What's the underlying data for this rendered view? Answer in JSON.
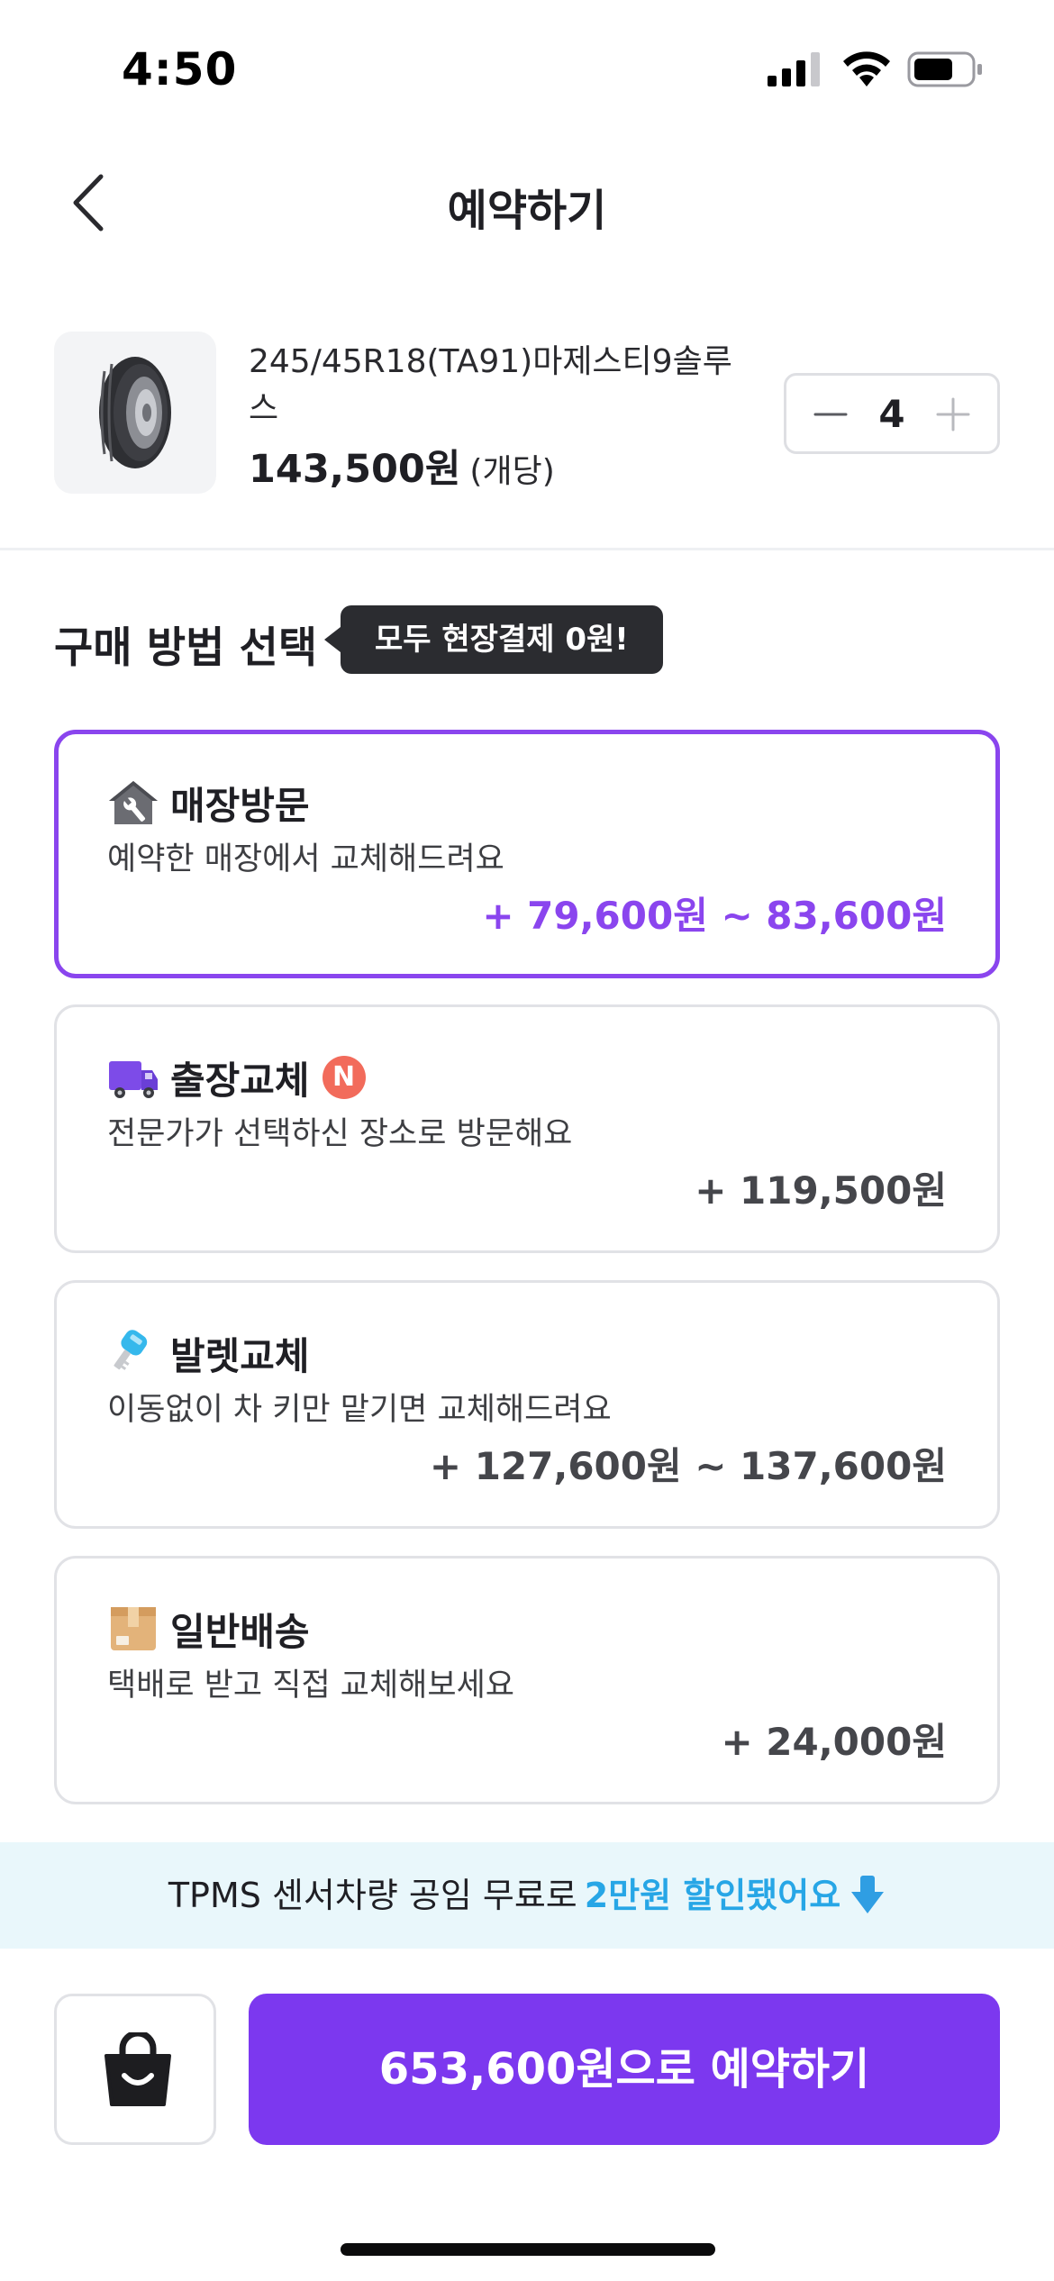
{
  "status_bar": {
    "time": "4:50"
  },
  "header": {
    "title": "예약하기"
  },
  "product": {
    "name": "245/45R18(TA91)마제스티9솔루스",
    "price": "143,500원",
    "unit": "(개당)",
    "quantity": "4"
  },
  "purchase_method": {
    "title": "구매 방법 선택",
    "tooltip": "모두 현장결제 0원!",
    "options": [
      {
        "title": "매장방문",
        "desc": "예약한 매장에서 교체해드려요",
        "price": "+ 79,600원 ~ 83,600원",
        "selected": true,
        "icon": "shop-repair-icon"
      },
      {
        "title": "출장교체",
        "badge": "N",
        "desc": "전문가가 선택하신 장소로 방문해요",
        "price": "+ 119,500원",
        "selected": false,
        "icon": "delivery-truck-icon"
      },
      {
        "title": "발렛교체",
        "desc": "이동없이 차 키만 맡기면 교체해드려요",
        "price": "+ 127,600원 ~ 137,600원",
        "selected": false,
        "icon": "car-key-icon"
      },
      {
        "title": "일반배송",
        "desc": "택배로 받고 직접 교체해보세요",
        "price": "+ 24,000원",
        "selected": false,
        "icon": "package-box-icon"
      }
    ]
  },
  "promo": {
    "text": "TPMS 센서차량 공임 무료로",
    "highlight": "2만원 할인됐어요",
    "icon": "down-arrow-icon"
  },
  "bottom_bar": {
    "cart_icon": "shopping-bag-icon",
    "reserve_label": "653,600원으로 예약하기"
  },
  "colors": {
    "accent": "#7c38ef",
    "selected_border": "#8a45ee",
    "promo_bg": "#e9f7fb",
    "promo_highlight": "#27a6e6",
    "tooltip_bg": "#2b2c30",
    "new_badge": "#f26b5b"
  }
}
